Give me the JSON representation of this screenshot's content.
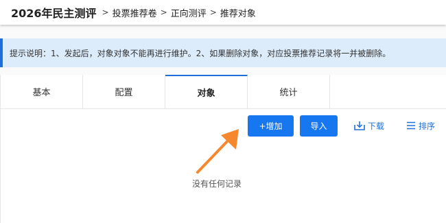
{
  "header": {
    "title": "2026年民主测评",
    "separator": ">",
    "breadcrumbs": [
      "投票推荐卷",
      "正向测评",
      "推荐对象"
    ]
  },
  "notice": {
    "text": "提示说明：1、发起后，对象对象不能再进行维护。2、如果删除对象，对应投票推荐记录将一并被删除。"
  },
  "tabs": [
    {
      "label": "基本",
      "active": false
    },
    {
      "label": "配置",
      "active": false
    },
    {
      "label": "对象",
      "active": true
    },
    {
      "label": "统计",
      "active": false
    }
  ],
  "toolbar": {
    "add_label": "+增加",
    "import_label": "导入",
    "download_label": "下载",
    "sort_label": "排序"
  },
  "empty_state": {
    "text": "没有任何记录"
  },
  "colors": {
    "primary": "#1777f0",
    "link": "#1e6fd9",
    "notice_bg": "#dcecfb",
    "arrow": "#f5872d"
  },
  "icons": {
    "download": "download-icon",
    "sort": "sort-list-icon",
    "annotation": "arrow-annotation"
  }
}
